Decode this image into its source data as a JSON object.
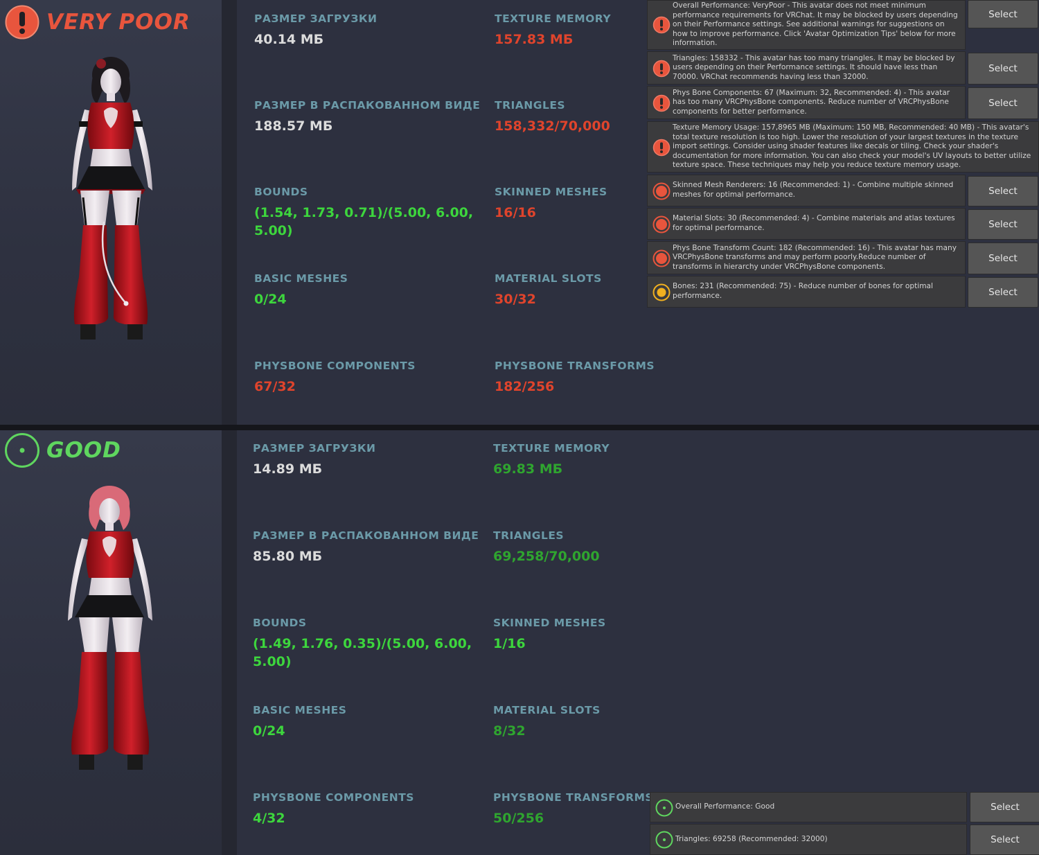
{
  "colors": {
    "label": "#6b9aa8",
    "white": "#dcdcdc",
    "red": "#e0442c",
    "green": "#3dd63d",
    "dark_green": "#2fa52f",
    "very_poor": "#e8553d",
    "good": "#5fd65f",
    "warn_orange": "#f0b020"
  },
  "top": {
    "rating": {
      "label": "VERY POOR",
      "icon": "exclamation-circle-icon"
    },
    "stats": {
      "download_size": {
        "label": "РАЗМЕР ЗАГРУЗКИ",
        "value": "40.14 МБ"
      },
      "uncompressed_size": {
        "label": "РАЗМЕР В РАСПАКОВАННОМ ВИДЕ",
        "value": "188.57 МБ"
      },
      "bounds": {
        "label": "BOUNDS",
        "value": "(1.54, 1.73, 0.71)/(5.00, 6.00, 5.00)"
      },
      "basic_meshes": {
        "label": "BASIC MESHES",
        "value": "0/24"
      },
      "physbone_components": {
        "label": "PHYSBONE COMPONENTS",
        "value": "67/32"
      },
      "texture_memory": {
        "label": "TEXTURE MEMORY",
        "value": "157.83 МБ"
      },
      "triangles": {
        "label": "TRIANGLES",
        "value": "158,332/70,000"
      },
      "skinned_meshes": {
        "label": "SKINNED MESHES",
        "value": "16/16"
      },
      "material_slots": {
        "label": "MATERIAL SLOTS",
        "value": "30/32"
      },
      "physbone_transforms": {
        "label": "PHYSBONE TRANSFORMS",
        "value": "182/256"
      }
    },
    "warnings": [
      {
        "icon": "error-icon",
        "text": "Overall Performance: VeryPoor - This avatar does not meet minimum performance requirements for VRChat. It may be blocked by users depending on their Performance settings. See additional warnings for suggestions on how to improve performance. Click 'Avatar Optimization Tips' below for more information.",
        "button": "Select"
      },
      {
        "icon": "error-icon",
        "text": "Triangles: 158332 - This avatar has too many triangles. It may be blocked by users depending on their Performance settings. It should have less than 70000. VRChat recommends having less than 32000.",
        "button": "Select"
      },
      {
        "icon": "error-icon",
        "text": "Phys Bone Components: 67 (Maximum: 32, Recommended: 4) - This avatar has too many VRCPhysBone components. Reduce number of VRCPhysBone components for better performance.",
        "button": "Select"
      },
      {
        "icon": "error-icon",
        "text": "Texture Memory Usage: 157,8965 MB (Maximum: 150 MB, Recommended: 40 MB) - This avatar's total texture resolution is too high. Lower the resolution of your largest textures in the texture import settings. Consider using shader features like decals or tiling. Check your shader's documentation for more information. You can also check your model's UV layouts to better utilize texture space. These techniques may help you reduce texture memory usage."
      },
      {
        "icon": "poor-icon",
        "text": "Skinned Mesh Renderers: 16 (Recommended: 1) - Combine multiple skinned meshes for optimal performance.",
        "button": "Select"
      },
      {
        "icon": "poor-icon",
        "text": "Material Slots: 30 (Recommended: 4) - Combine materials and atlas textures for optimal performance.",
        "button": "Select"
      },
      {
        "icon": "poor-icon",
        "text": "Phys Bone Transform Count: 182 (Recommended: 16) - This avatar has many VRCPhysBone transforms and may perform poorly.Reduce number of transforms in hierarchy under VRCPhysBone components.",
        "button": "Select"
      },
      {
        "icon": "medium-icon",
        "text": "Bones: 231 (Recommended: 75) - Reduce number of bones for optimal performance.",
        "button": "Select"
      }
    ]
  },
  "bottom": {
    "rating": {
      "label": "GOOD",
      "icon": "good-dot-circle-icon"
    },
    "stats": {
      "download_size": {
        "label": "РАЗМЕР ЗАГРУЗКИ",
        "value": "14.89 МБ"
      },
      "uncompressed_size": {
        "label": "РАЗМЕР В РАСПАКОВАННОМ ВИДЕ",
        "value": "85.80 МБ"
      },
      "bounds": {
        "label": "BOUNDS",
        "value": "(1.49, 1.76, 0.35)/(5.00, 6.00, 5.00)"
      },
      "basic_meshes": {
        "label": "BASIC MESHES",
        "value": "0/24"
      },
      "physbone_components": {
        "label": "PHYSBONE COMPONENTS",
        "value": "4/32"
      },
      "texture_memory": {
        "label": "TEXTURE MEMORY",
        "value": "69.83 МБ"
      },
      "triangles": {
        "label": "TRIANGLES",
        "value": "69,258/70,000"
      },
      "skinned_meshes": {
        "label": "SKINNED MESHES",
        "value": "1/16"
      },
      "material_slots": {
        "label": "MATERIAL SLOTS",
        "value": "8/32"
      },
      "physbone_transforms": {
        "label": "PHYSBONE TRANSFORMS",
        "value": "50/256"
      }
    },
    "warnings": [
      {
        "icon": "good-icon",
        "text": "Overall Performance: Good",
        "button": "Select"
      },
      {
        "icon": "good-icon",
        "text": "Triangles: 69258 (Recommended: 32000)",
        "button": "Select"
      }
    ]
  }
}
